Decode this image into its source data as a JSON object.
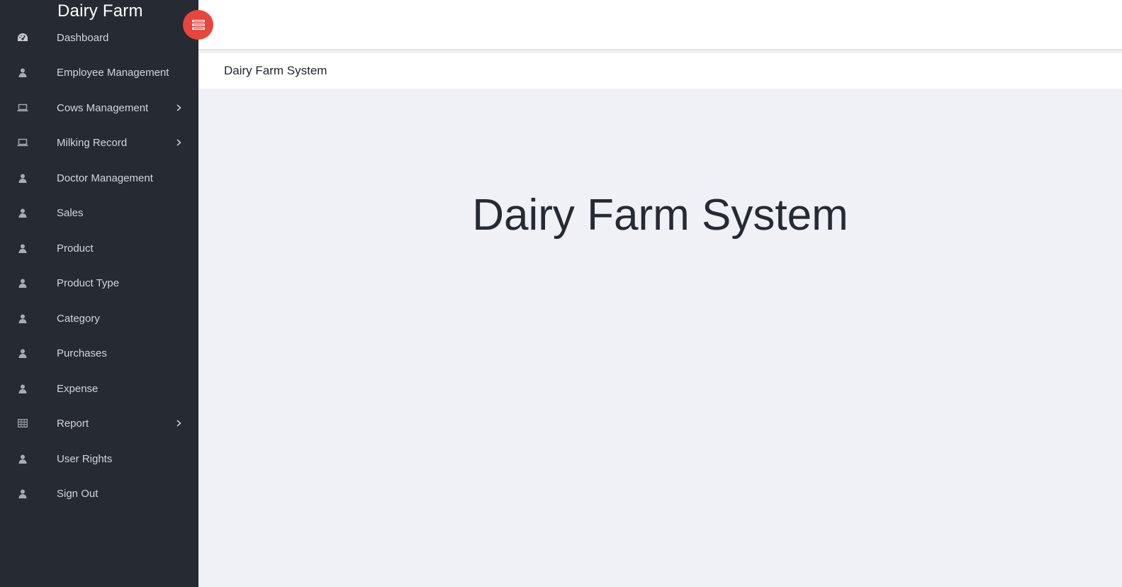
{
  "brand": {
    "title": "Dairy Farm"
  },
  "sidebar": {
    "items": [
      {
        "label": "Dashboard",
        "icon": "dashboard-icon",
        "has_submenu": false
      },
      {
        "label": "Employee Management",
        "icon": "user-icon",
        "has_submenu": false
      },
      {
        "label": "Cows Management",
        "icon": "laptop-icon",
        "has_submenu": true
      },
      {
        "label": "Milking Record",
        "icon": "laptop-icon",
        "has_submenu": true
      },
      {
        "label": "Doctor Management",
        "icon": "user-icon",
        "has_submenu": false
      },
      {
        "label": "Sales",
        "icon": "user-icon",
        "has_submenu": false
      },
      {
        "label": "Product",
        "icon": "user-icon",
        "has_submenu": false
      },
      {
        "label": "Product Type",
        "icon": "user-icon",
        "has_submenu": false
      },
      {
        "label": "Category",
        "icon": "user-icon",
        "has_submenu": false
      },
      {
        "label": "Purchases",
        "icon": "user-icon",
        "has_submenu": false
      },
      {
        "label": "Expense",
        "icon": "user-icon",
        "has_submenu": false
      },
      {
        "label": "Report",
        "icon": "table-icon",
        "has_submenu": true
      },
      {
        "label": "User Rights",
        "icon": "user-icon",
        "has_submenu": false
      },
      {
        "label": "Sign Out",
        "icon": "user-icon",
        "has_submenu": false
      }
    ]
  },
  "toggle": {
    "icon": "menu-toggle-icon",
    "color": "#e8453c"
  },
  "breadcrumb": {
    "text": "Dairy Farm System"
  },
  "main": {
    "heading": "Dairy Farm System"
  },
  "colors": {
    "sidebar_bg": "#262a33",
    "content_bg": "#f0f1f6",
    "accent": "#e8453c"
  }
}
